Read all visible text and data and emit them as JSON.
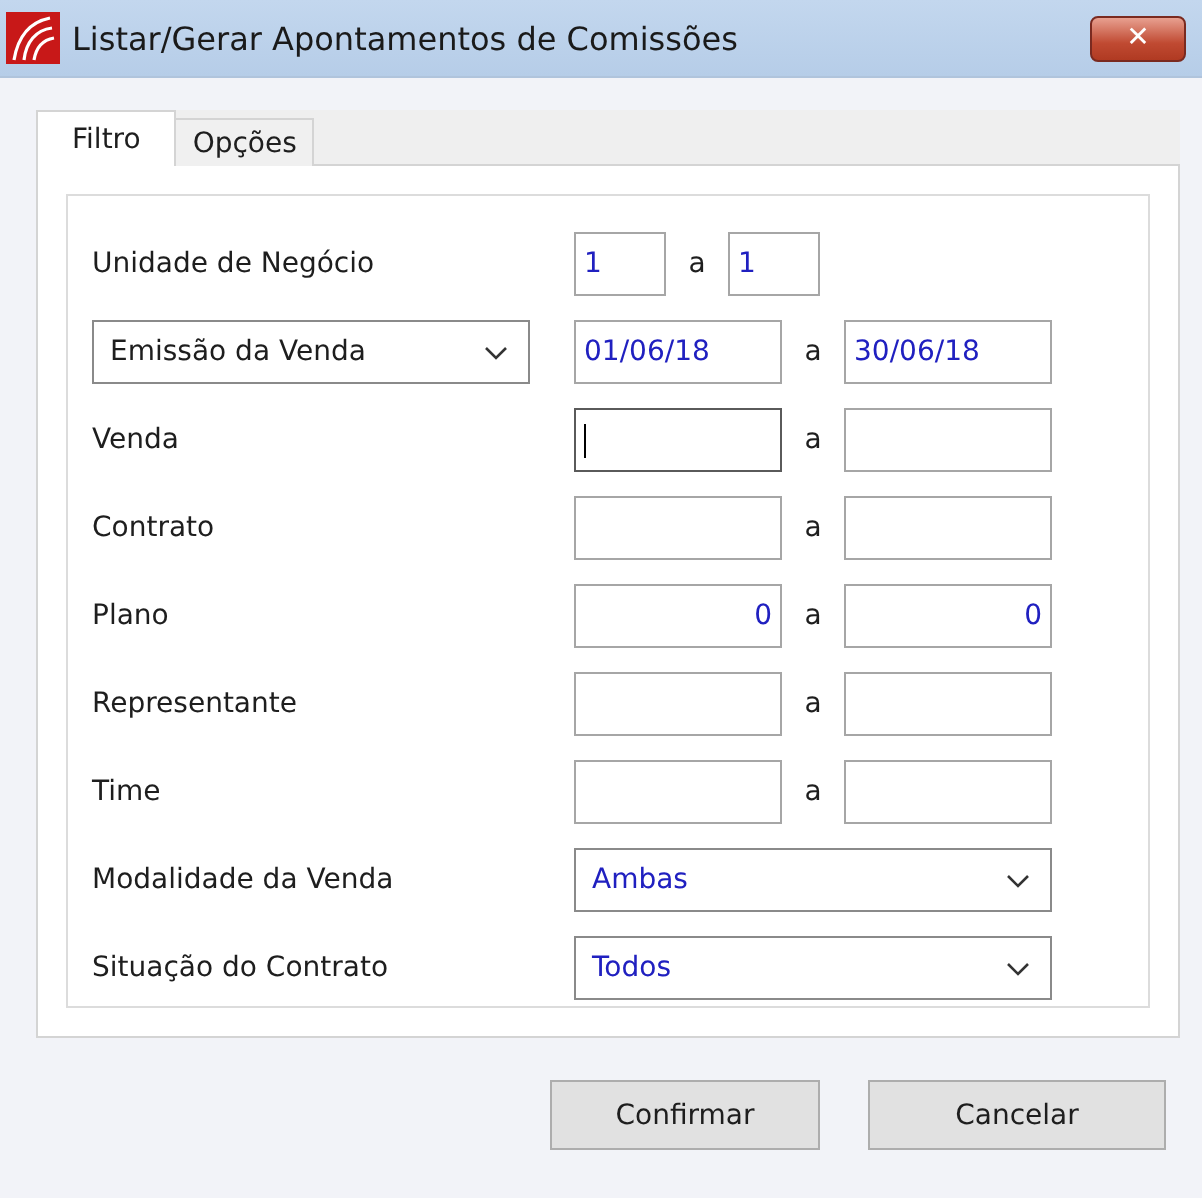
{
  "window": {
    "title": "Listar/Gerar Apontamentos de Comissões",
    "close_label": "✕"
  },
  "tabs": [
    {
      "label": "Filtro",
      "selected": true
    },
    {
      "label": "Opções",
      "selected": false
    }
  ],
  "rows": [
    {
      "kind": "short_range",
      "label": "Unidade de Negócio",
      "from": {
        "value": "1",
        "focused": false
      },
      "separator": "a",
      "to": {
        "value": "1"
      }
    },
    {
      "kind": "select_range",
      "select": "Emissão da Venda",
      "from": {
        "value": "01/06/18",
        "focused": false
      },
      "separator": "a",
      "to": {
        "value": "30/06/18"
      }
    },
    {
      "kind": "range",
      "label": "Venda",
      "from": {
        "focused": true
      },
      "separator": "a",
      "to": {}
    },
    {
      "kind": "range",
      "label": "Contrato",
      "from": {
        "focused": false
      },
      "separator": "a",
      "to": {}
    },
    {
      "kind": "number_range",
      "label": "Plano",
      "from": {
        "value": "0",
        "focused": false
      },
      "separator": "a",
      "to": {
        "value": "0"
      }
    },
    {
      "kind": "range",
      "label": "Representante",
      "from": {
        "focused": false
      },
      "separator": "a",
      "to": {}
    },
    {
      "kind": "range",
      "label": "Time",
      "from": {
        "focused": false
      },
      "separator": "a",
      "to": {}
    },
    {
      "kind": "dropdown",
      "label": "Modalidade da Venda",
      "value": "Ambas"
    },
    {
      "kind": "dropdown",
      "label": "Situação do Contrato",
      "value": "Todos"
    }
  ],
  "buttons": [
    {
      "label": "Confirmar"
    },
    {
      "label": "Cancelar"
    }
  ]
}
